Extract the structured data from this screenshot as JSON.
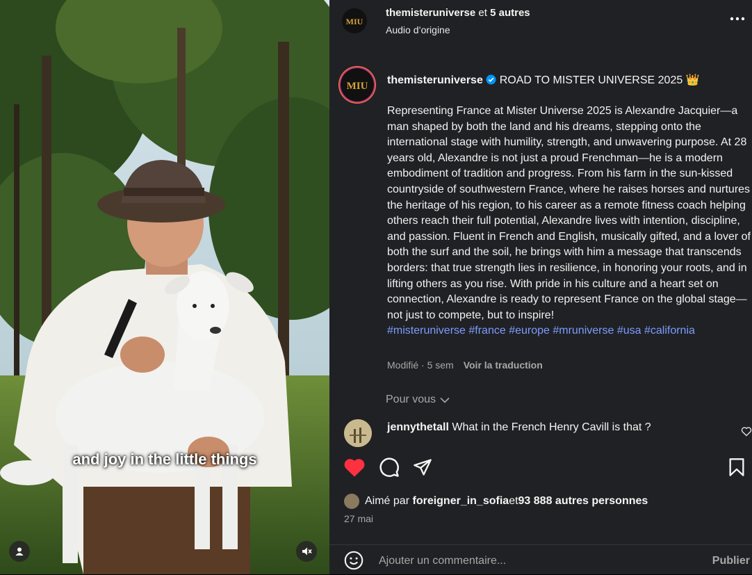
{
  "media": {
    "subtitle": "and joy in the little things"
  },
  "header": {
    "account": "themisteruniverse",
    "connector": " et ",
    "others": "5 autres",
    "audio": "Audio d’origine"
  },
  "post": {
    "account": "themisteruniverse",
    "headline": "ROAD TO MISTER UNIVERSE 2025",
    "headline_emoji": "👑",
    "body": "Representing France at Mister Universe 2025 is Alexandre Jacquier—a man shaped by both the land and his dreams, stepping onto the international stage with humility, strength, and unwavering purpose. At 28 years old, Alexandre is not just a proud Frenchman—he is a modern embodiment of tradition and progress. From his farm in the sun-kissed countryside of southwestern France, where he raises horses and nurtures the heritage of his region, to his career as a remote fitness coach helping others reach their full potential, Alexandre lives with intention, discipline, and passion. Fluent in French and English, musically gifted, and a lover of both the surf and the soil, he brings with him a message that transcends borders: that true strength lies in resilience, in honoring your roots, and in lifting others as you rise. With pride in his culture and a heart set on connection, Alexandre is ready to represent France on the global stage—not just to compete, but to inspire!",
    "hashtags": "#misteruniverse #france #europe #mruniverse #usa #california",
    "meta_edited": "Modifié · 5 sem",
    "translate": "Voir la traduction"
  },
  "for_you": "Pour vous",
  "comment": {
    "user": "jennythetall",
    "text": "What in the French Henry Cavill is that ?"
  },
  "likes": {
    "prefix": "Aimé par ",
    "user": "foreigner_in_sofia",
    "connector": " et ",
    "count": "93 888 autres personnes"
  },
  "date": "27 mai",
  "composer": {
    "placeholder": "Ajouter un commentaire...",
    "submit": "Publier"
  },
  "colors": {
    "like_red": "#ff3040",
    "hashtag_blue": "#7d9cff",
    "verified_blue": "#0095f6",
    "panel_bg": "#202124"
  }
}
